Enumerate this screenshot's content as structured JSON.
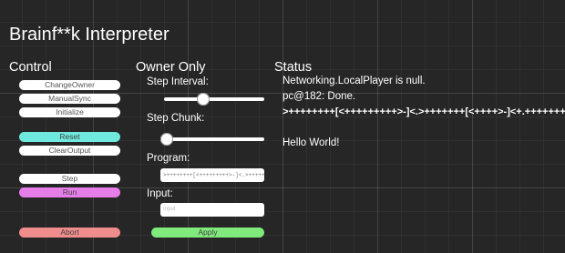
{
  "app": {
    "title": "Brainf**k Interpreter"
  },
  "control": {
    "heading": "Control",
    "buttons": {
      "change_owner": "ChangeOwner",
      "manual_sync": "ManualSync",
      "initialize": "Initialize",
      "reset": "Reset",
      "clear_output": "ClearOutput",
      "step": "Step",
      "run": "Run",
      "abort": "Abort"
    },
    "colors": {
      "reset": "#6fe8de",
      "run": "#e77de8",
      "abort": "#ef8c8c"
    }
  },
  "owner": {
    "heading": "Owner Only",
    "step_interval": {
      "label": "Step Interval:",
      "value": 0.4
    },
    "step_chunk": {
      "label": "Step Chunk:",
      "value": 0.0
    },
    "program": {
      "label": "Program:",
      "value": ">++++++++[<+++++++++>-]<.>+++++++[<++++>-]<+.+++++"
    },
    "input": {
      "label": "Input:",
      "placeholder": "Input"
    },
    "apply_label": "Apply",
    "apply_color": "#80ea7c"
  },
  "status": {
    "heading": "Status",
    "line1": "Networking.LocalPlayer is null.",
    "line2": "pc@182: Done.",
    "program": ">++++++++[<+++++++++>-]<.>+++++++[<++++>-]<+.+++++++..+++.>>++++++[<+++++++>-]<++.------------.",
    "output": "Hello World!"
  }
}
